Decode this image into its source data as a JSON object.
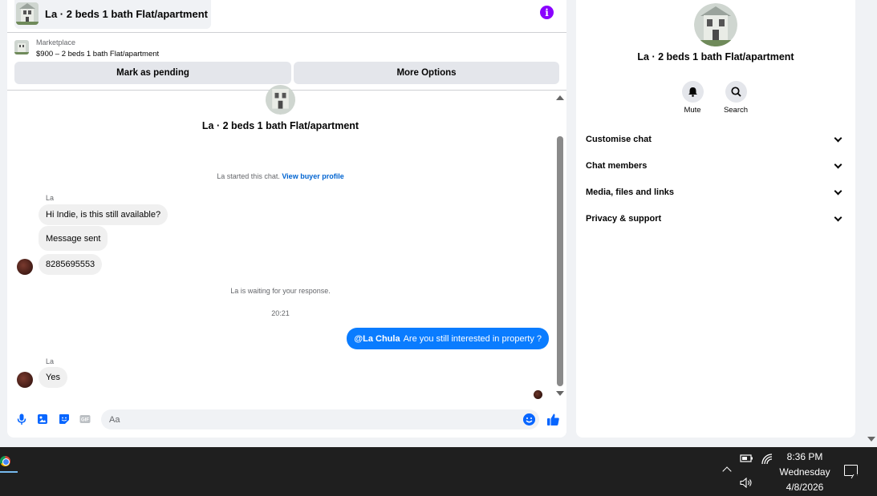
{
  "chat": {
    "title": "La · 2 beds 1 bath Flat/apartment",
    "listing": {
      "marketplace_label": "Marketplace",
      "price_title": "$900 – 2 beds 1 bath Flat/apartment"
    },
    "buttons": {
      "mark_pending": "Mark as pending",
      "more_options": "More Options"
    },
    "thread_title": "La · 2 beds 1 bath Flat/apartment",
    "started_text": "La started this chat.",
    "buyer_profile_link": "View buyer profile",
    "messages": [
      {
        "sender": "La",
        "text": "Hi Indie, is this still available?"
      },
      {
        "text": "Message sent"
      },
      {
        "text": "8285695553"
      }
    ],
    "waiting_text": "La is waiting for your response.",
    "timestamp": "20:21",
    "outgoing": {
      "mention": "@La Chula",
      "text": "Are you still interested in property ?"
    },
    "reply": {
      "sender": "La",
      "text": "Yes"
    },
    "composer_placeholder": "Aa",
    "accent_color": "#0866ff"
  },
  "info": {
    "title": "La · 2 beds 1 bath Flat/apartment",
    "actions": [
      {
        "label": "Mute",
        "icon": "bell-icon"
      },
      {
        "label": "Search",
        "icon": "search-icon"
      }
    ],
    "sections": [
      "Customise chat",
      "Chat members",
      "Media, files and links",
      "Privacy & support"
    ]
  },
  "taskbar": {
    "time": "8:36 PM",
    "day": "Wednesday",
    "date": "4/8/2026"
  }
}
